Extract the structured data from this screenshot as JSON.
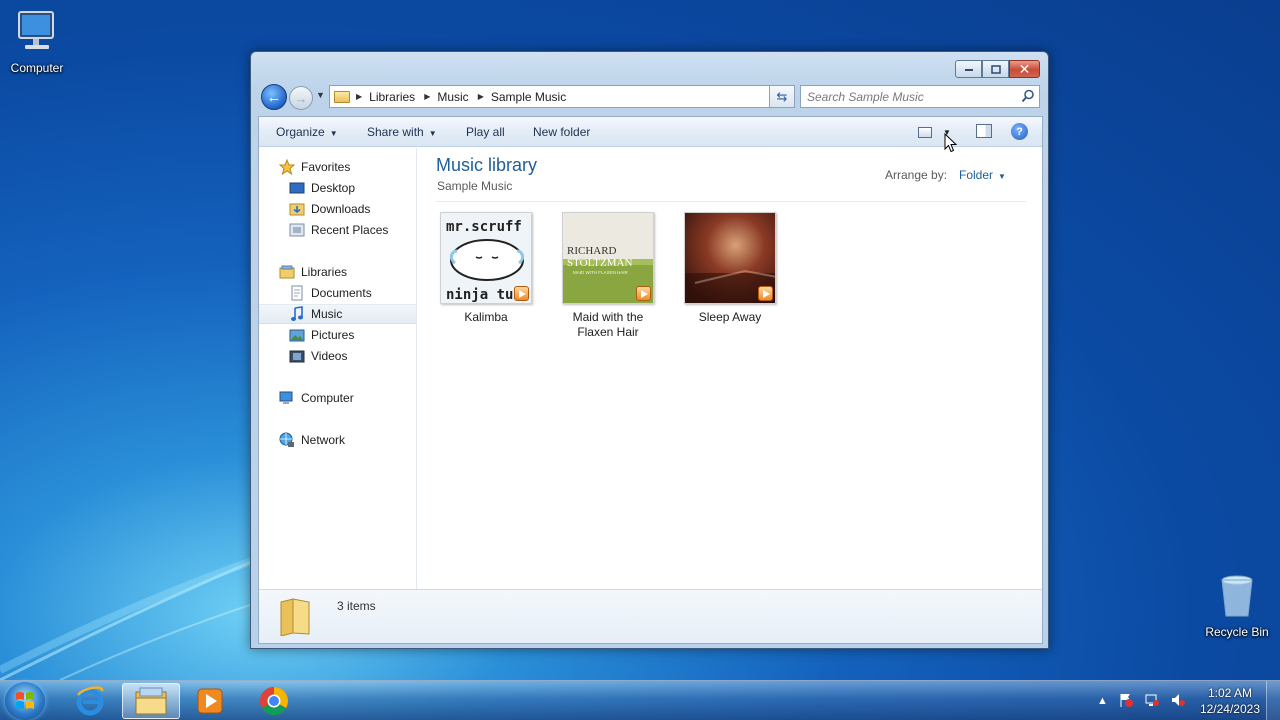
{
  "desktop": {
    "computer_label": "Computer",
    "recycle_label": "Recycle Bin"
  },
  "window": {
    "breadcrumb": [
      "Libraries",
      "Music",
      "Sample Music"
    ],
    "search_placeholder": "Search Sample Music",
    "toolbar": {
      "organize": "Organize",
      "share_with": "Share with",
      "play_all": "Play all",
      "new_folder": "New folder"
    },
    "nav": {
      "favorites": "Favorites",
      "desktop": "Desktop",
      "downloads": "Downloads",
      "recent_places": "Recent Places",
      "libraries": "Libraries",
      "documents": "Documents",
      "music": "Music",
      "pictures": "Pictures",
      "videos": "Videos",
      "computer": "Computer",
      "network": "Network"
    },
    "content": {
      "title": "Music library",
      "subtitle": "Sample Music",
      "arrange_label": "Arrange by:",
      "arrange_value": "Folder",
      "items": [
        {
          "name": "Kalimba",
          "art_text_top": "mr.scruff",
          "art_text_bottom": "ninja tun"
        },
        {
          "name": "Maid with the Flaxen Hair",
          "art_text_top": "RICHARD",
          "art_text_bottom": "STOLTZMAN",
          "art_text_small": "MAID WITH FLAXEN HAIR"
        },
        {
          "name": "Sleep Away"
        }
      ]
    },
    "details": {
      "count": "3 items"
    }
  },
  "taskbar": {
    "time": "1:02 AM",
    "date": "12/24/2023"
  },
  "colors": {
    "accent": "#1e5e9a",
    "selection": "#e3ebf3"
  }
}
